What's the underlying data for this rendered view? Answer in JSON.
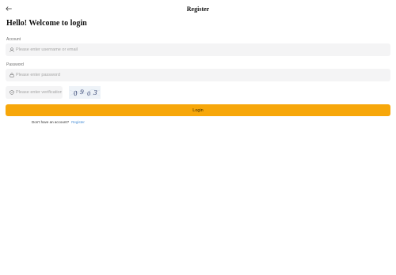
{
  "header": {
    "title": "Register",
    "back_icon": "arrow-left-icon"
  },
  "welcome_text": "Hello! Welcome to login",
  "account": {
    "label": "Account",
    "placeholder": "Please enter username or email",
    "value": "",
    "icon": "user-icon"
  },
  "password": {
    "label": "Password",
    "placeholder": "Please enter password",
    "value": "",
    "icon": "lock-icon"
  },
  "verification": {
    "placeholder": "Please enter verification code",
    "value": "",
    "icon": "shield-icon",
    "captcha_code": "0903"
  },
  "login_button": "Login",
  "register_prompt": {
    "text": "Don't have an account?",
    "link": "Register"
  },
  "colors": {
    "accent": "#f7a70a",
    "link": "#4a8fd6",
    "input_bg": "#f4f4f5"
  }
}
